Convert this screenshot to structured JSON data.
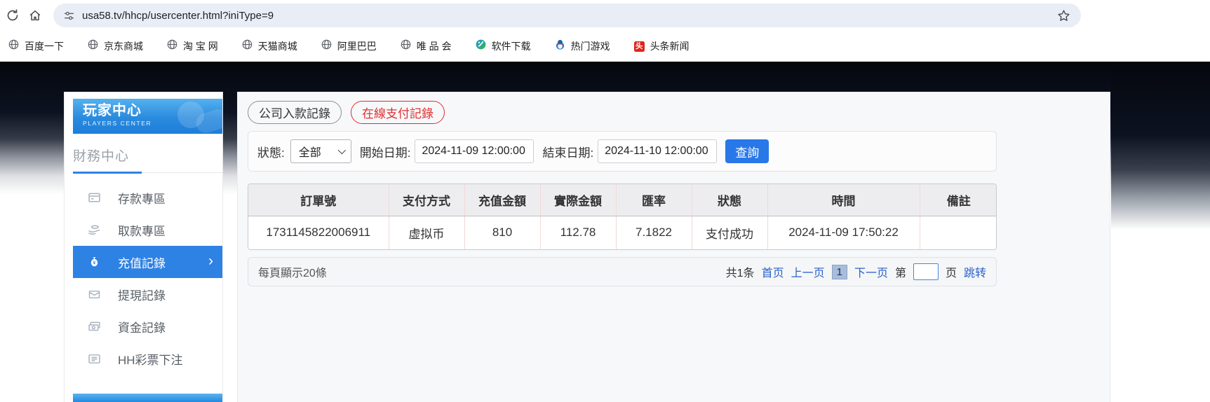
{
  "browser": {
    "url": "usa58.tv/hhcp/usercenter.html?iniType=9",
    "bookmarks": [
      {
        "label": "百度一下",
        "icon": "globe-icon"
      },
      {
        "label": "京东商城",
        "icon": "globe-icon"
      },
      {
        "label": "淘 宝 网",
        "icon": "globe-icon"
      },
      {
        "label": "天猫商城",
        "icon": "globe-icon"
      },
      {
        "label": "阿里巴巴",
        "icon": "globe-icon"
      },
      {
        "label": "唯 品 会",
        "icon": "globe-icon"
      },
      {
        "label": "软件下载",
        "icon": "software-download-icon"
      },
      {
        "label": "热门游戏",
        "icon": "penguin-icon"
      },
      {
        "label": "头条新闻",
        "icon": "toutiao-icon",
        "icon_text": "头"
      }
    ]
  },
  "sidebar": {
    "title": "玩家中心",
    "subtitle": "PLAYERS CENTER",
    "section": "財務中心",
    "items": [
      {
        "label": "存款專區",
        "icon": "deposit-icon",
        "active": false
      },
      {
        "label": "取款專區",
        "icon": "withdraw-icon",
        "active": false
      },
      {
        "label": "充值記錄",
        "icon": "moneybag-icon",
        "active": true,
        "chevron": "›"
      },
      {
        "label": "提現記錄",
        "icon": "wallet-icon",
        "active": false
      },
      {
        "label": "資金記錄",
        "icon": "banknotes-icon",
        "active": false
      },
      {
        "label": "HH彩票下注",
        "icon": "list-icon",
        "active": false
      }
    ]
  },
  "main": {
    "tabs": [
      {
        "label": "公司入款記錄",
        "active": false
      },
      {
        "label": "在線支付記錄",
        "active": true
      }
    ],
    "filters": {
      "status_label": "狀態:",
      "status_value": "全部",
      "start_label": "開始日期:",
      "start_value": "2024-11-09 12:00:00",
      "end_label": "結束日期:",
      "end_value": "2024-11-10 12:00:00",
      "search_label": "查詢"
    },
    "table": {
      "headers": [
        "訂單號",
        "支付方式",
        "充值金額",
        "實際金額",
        "匯率",
        "狀態",
        "時間",
        "備註"
      ],
      "rows": [
        [
          "1731145822006911",
          "虚拟币",
          "810",
          "112.78",
          "7.1822",
          "支付成功",
          "2024-11-09 17:50:22",
          ""
        ]
      ]
    },
    "pagination": {
      "page_size_text": "每頁顯示20條",
      "total_text": "共1条",
      "first": "首页",
      "prev": "上一页",
      "current": "1",
      "next": "下一页",
      "jump_pre": "第",
      "jump_value": "",
      "jump_post": "页",
      "jump_action": "跳转"
    }
  },
  "colors": {
    "accent_blue": "#2e82e4",
    "button_blue": "#2878e8",
    "tab_red": "#e03030",
    "link_blue": "#2a62c9",
    "banner_gradient_top": "#55b1ef",
    "banner_gradient_bottom": "#1d7ed9",
    "table_header_bg": "#ededef",
    "table_divider_pink": "#f3d8d8"
  }
}
